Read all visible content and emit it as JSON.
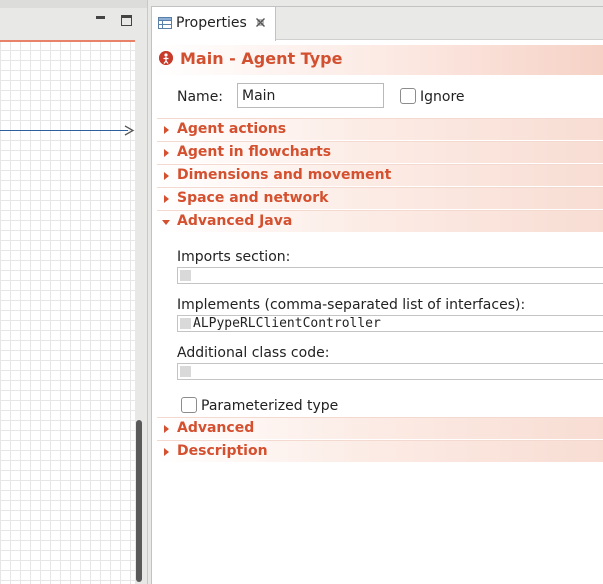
{
  "properties_tab": {
    "label": "Properties"
  },
  "header": {
    "title": "Main - Agent Type"
  },
  "name_field": {
    "label": "Name:",
    "value": "Main"
  },
  "ignore_checkbox": {
    "label": "Ignore",
    "checked": false
  },
  "sections": [
    {
      "label": "Agent actions",
      "expanded": false
    },
    {
      "label": "Agent in flowcharts",
      "expanded": false
    },
    {
      "label": "Dimensions and movement",
      "expanded": false
    },
    {
      "label": "Space and network",
      "expanded": false
    },
    {
      "label": "Advanced Java",
      "expanded": true
    },
    {
      "label": "Advanced",
      "expanded": false
    },
    {
      "label": "Description",
      "expanded": false
    }
  ],
  "advanced_java": {
    "imports_label": "Imports section:",
    "imports_value": "",
    "implements_label": "Implements (comma-separated list of interfaces):",
    "implements_value": "ALPypeRLClientController",
    "additional_label": "Additional class code:",
    "additional_value": "",
    "parameterized_label": "Parameterized type",
    "parameterized_checked": false
  },
  "colors": {
    "accent": "#d4502f",
    "connector": "#2d5f9e",
    "error_icon": "#c83a2a"
  },
  "icons": {
    "tab_icon": "properties-table-icon",
    "tab_close": "close-icon",
    "header_icon": "agent-error-icon"
  }
}
